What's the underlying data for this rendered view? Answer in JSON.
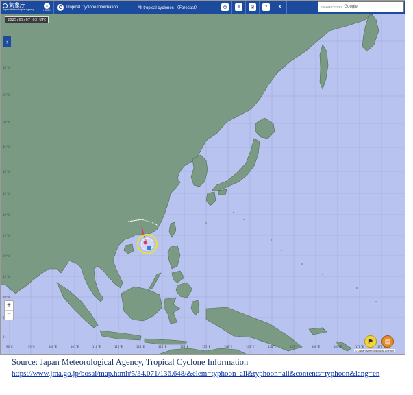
{
  "header": {
    "logo_text": "気象庁",
    "logo_subtext": "Japan Meteorological Agency",
    "home_label": "HOME",
    "tc_info_label": "Tropical Cyclone Information",
    "forecast_label": "All tropical cyclones （Forecast）",
    "search_prefix": "ENHANCED BY",
    "search_brand": "Google"
  },
  "map": {
    "datetime": "2025/09/07 03 UTC",
    "attribution": "© Japan Meteorological Agency",
    "lat_labels": [
      "60°N",
      "55°N",
      "50°N",
      "45°N",
      "40°N",
      "35°N",
      "30°N",
      "25°N",
      "20°N",
      "15°N",
      "10°N",
      "5°N",
      "0°"
    ],
    "lon_labels": [
      "90°E",
      "95°E",
      "100°E",
      "105°E",
      "110°E",
      "115°E",
      "120°E",
      "125°E",
      "130°E",
      "135°E",
      "140°E",
      "145°E",
      "150°E",
      "155°E",
      "160°E",
      "165°E",
      "170°E",
      "175°E"
    ],
    "zoom_in": "+",
    "zoom_out": "−",
    "colors": {
      "ocean": "#b9c3ef",
      "land": "#7b9a83",
      "track": "#d23a6a",
      "forecast_circle": "#e8e03a"
    }
  },
  "caption": {
    "source": "Source: Japan Meteorological  Agency, Tropical Cyclone Information",
    "url": "https://www.jma.go.jp/bosai/map.html#5/34.071/136.648/&elem=typhoon_all&typhoon=all&contents=typhoon&lang=en"
  }
}
